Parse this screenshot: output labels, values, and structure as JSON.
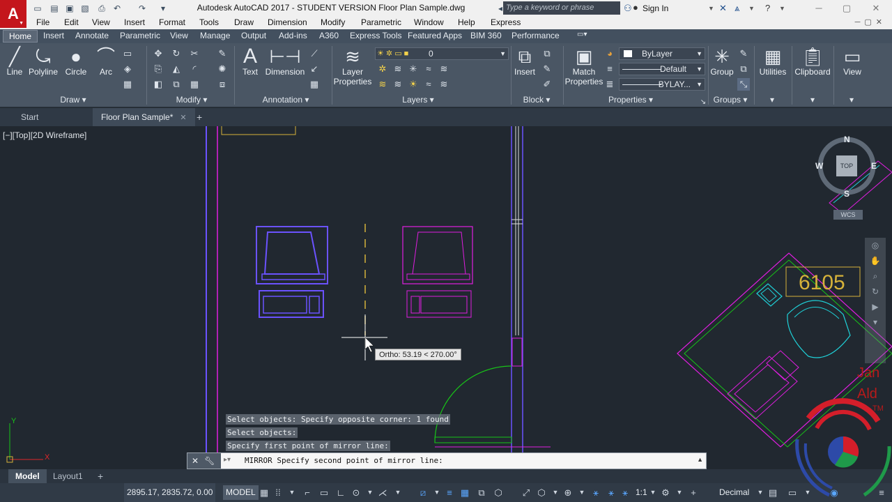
{
  "window": {
    "title": "Autodesk AutoCAD 2017 - STUDENT VERSION    Floor Plan Sample.dwg",
    "app_logo": "A",
    "search_placeholder": "Type a keyword or phrase",
    "sign_in": "Sign In"
  },
  "menu": [
    "File",
    "Edit",
    "View",
    "Insert",
    "Format",
    "Tools",
    "Draw",
    "Dimension",
    "Modify",
    "Parametric",
    "Window",
    "Help",
    "Express"
  ],
  "ribbon_tabs": [
    "Home",
    "Insert",
    "Annotate",
    "Parametric",
    "View",
    "Manage",
    "Output",
    "Add-ins",
    "A360",
    "Express Tools",
    "Featured Apps",
    "BIM 360",
    "Performance"
  ],
  "ribbon": {
    "draw": {
      "line": "Line",
      "polyline": "Polyline",
      "circle": "Circle",
      "arc": "Arc",
      "footer": "Draw"
    },
    "modify": {
      "footer": "Modify"
    },
    "annotation": {
      "text": "Text",
      "dimension": "Dimension",
      "footer": "Annotation"
    },
    "layers": {
      "layer_properties_1": "Layer",
      "layer_properties_2": "Properties",
      "current_layer": "0",
      "footer": "Layers"
    },
    "block": {
      "insert": "Insert",
      "footer": "Block"
    },
    "properties": {
      "match_1": "Match",
      "match_2": "Properties",
      "color": "ByLayer",
      "linetype": "Default",
      "lineweight": "BYLAY...",
      "footer": "Properties"
    },
    "groups": {
      "group": "Group",
      "footer": "Groups"
    },
    "utilities": "Utilities",
    "clipboard": "Clipboard",
    "view": "View"
  },
  "file_tabs": {
    "start": "Start",
    "active": "Floor Plan Sample*"
  },
  "viewport": {
    "label": "[−][Top][2D Wireframe]",
    "room_number": "6105",
    "ortho_tooltip": "Ortho: 53.19 < 270.00°",
    "partial_text_1": "Jan",
    "partial_text_2": "Ald",
    "partial_text_3": "TM"
  },
  "viewcube": {
    "north": "N",
    "south": "S",
    "east": "E",
    "west": "W",
    "top": "TOP",
    "wcs": "WCS"
  },
  "command_history": [
    "Select objects: Specify opposite corner: 1 found",
    "Select objects:",
    "Specify first point of mirror line:"
  ],
  "command_line": {
    "prompt": "MIRROR Specify second point of mirror line:"
  },
  "layout_tabs": [
    "Model",
    "Layout1"
  ],
  "status": {
    "coordinates": "2895.17, 2835.72, 0.00",
    "model": "MODEL",
    "scale": "1:1",
    "units": "Decimal"
  },
  "colors": {
    "background": "#212830",
    "ribbon": "#4a5664",
    "blue_geometry": "#6b52ff",
    "magenta_geometry": "#e01ee0",
    "cyan_geometry": "#1fd1d8",
    "yellow_text": "#d6b23a",
    "green_geometry": "#18c418"
  }
}
